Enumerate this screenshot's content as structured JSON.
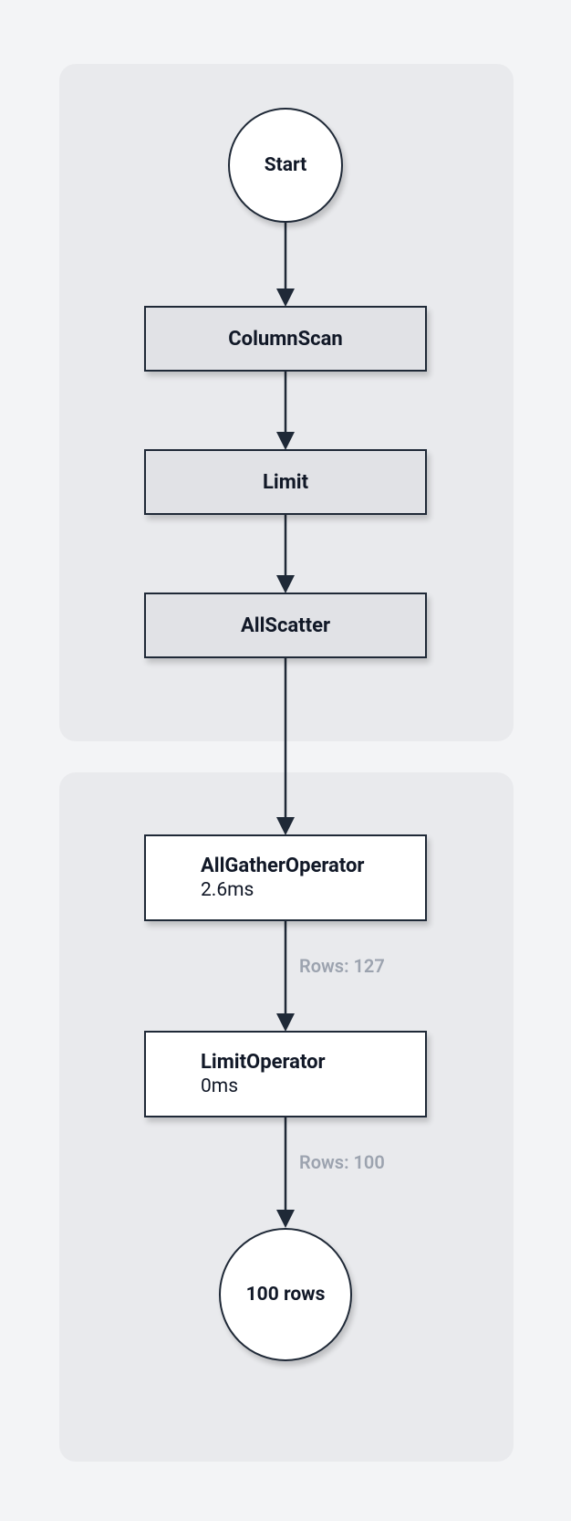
{
  "nodes": {
    "start": "Start",
    "columnScan": "ColumnScan",
    "limit": "Limit",
    "allScatter": "AllScatter",
    "allGather": {
      "title": "AllGatherOperator",
      "sub": "2.6ms"
    },
    "limitOp": {
      "title": "LimitOperator",
      "sub": "0ms"
    },
    "end": "100 rows"
  },
  "edges": {
    "gatherToLimit": "Rows: 127",
    "limitToEnd": "Rows: 100"
  }
}
